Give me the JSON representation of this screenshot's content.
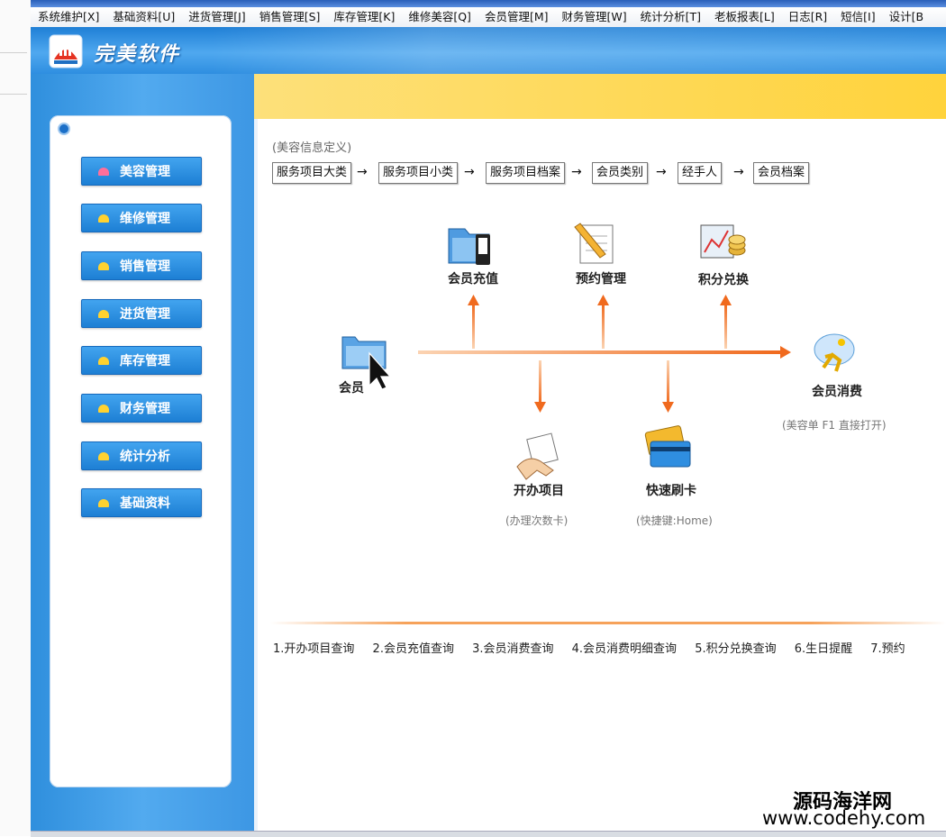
{
  "menubar": {
    "items": [
      "系统维护[X]",
      "基础资料[U]",
      "进货管理[J]",
      "销售管理[S]",
      "库存管理[K]",
      "维修美容[Q]",
      "会员管理[M]",
      "财务管理[W]",
      "统计分析[T]",
      "老板报表[L]",
      "日志[R]",
      "短信[I]",
      "设计[B"
    ]
  },
  "header": {
    "logo_text": "完美软件"
  },
  "sidebar": {
    "items": [
      {
        "label": "美容管理",
        "icon": "home-pink-icon"
      },
      {
        "label": "维修管理",
        "icon": "home-icon"
      },
      {
        "label": "销售管理",
        "icon": "home-icon"
      },
      {
        "label": "进货管理",
        "icon": "home-icon"
      },
      {
        "label": "库存管理",
        "icon": "home-icon"
      },
      {
        "label": "财务管理",
        "icon": "home-icon"
      },
      {
        "label": "统计分析",
        "icon": "home-icon"
      },
      {
        "label": "基础资料",
        "icon": "home-icon"
      }
    ]
  },
  "content": {
    "section_label": "(美容信息定义)",
    "flow": [
      "服务项目大类",
      "服务项目小类",
      "服务项目档案",
      "会员类别",
      "经手人",
      "会员档案"
    ],
    "flow_arrow": "→",
    "diagram": {
      "member_recharge": "会员充值",
      "appointment": "预约管理",
      "points_exchange": "积分兑换",
      "member_file": "会员",
      "member_consume": "会员消费",
      "member_consume_note": "(美容单 F1 直接打开)",
      "open_project": "开办项目",
      "open_project_note": "(办理次数卡)",
      "quick_card": "快速刷卡",
      "quick_card_note": "(快捷键:Home)"
    },
    "queries": [
      "1.开办项目查询",
      "2.会员充值查询",
      "3.会员消费查询",
      "4.会员消费明细查询",
      "5.积分兑换查询",
      "6.生日提醒",
      "7.预约"
    ]
  },
  "watermark": {
    "line1": "源码海洋网",
    "line2": "www.codehy.com"
  },
  "colors": {
    "accent_blue": "#2e8ee0",
    "sidebar_button": "#1d7fd4",
    "yellow_bar": "#ffd33c",
    "arrow_orange": "#f07a2a"
  }
}
